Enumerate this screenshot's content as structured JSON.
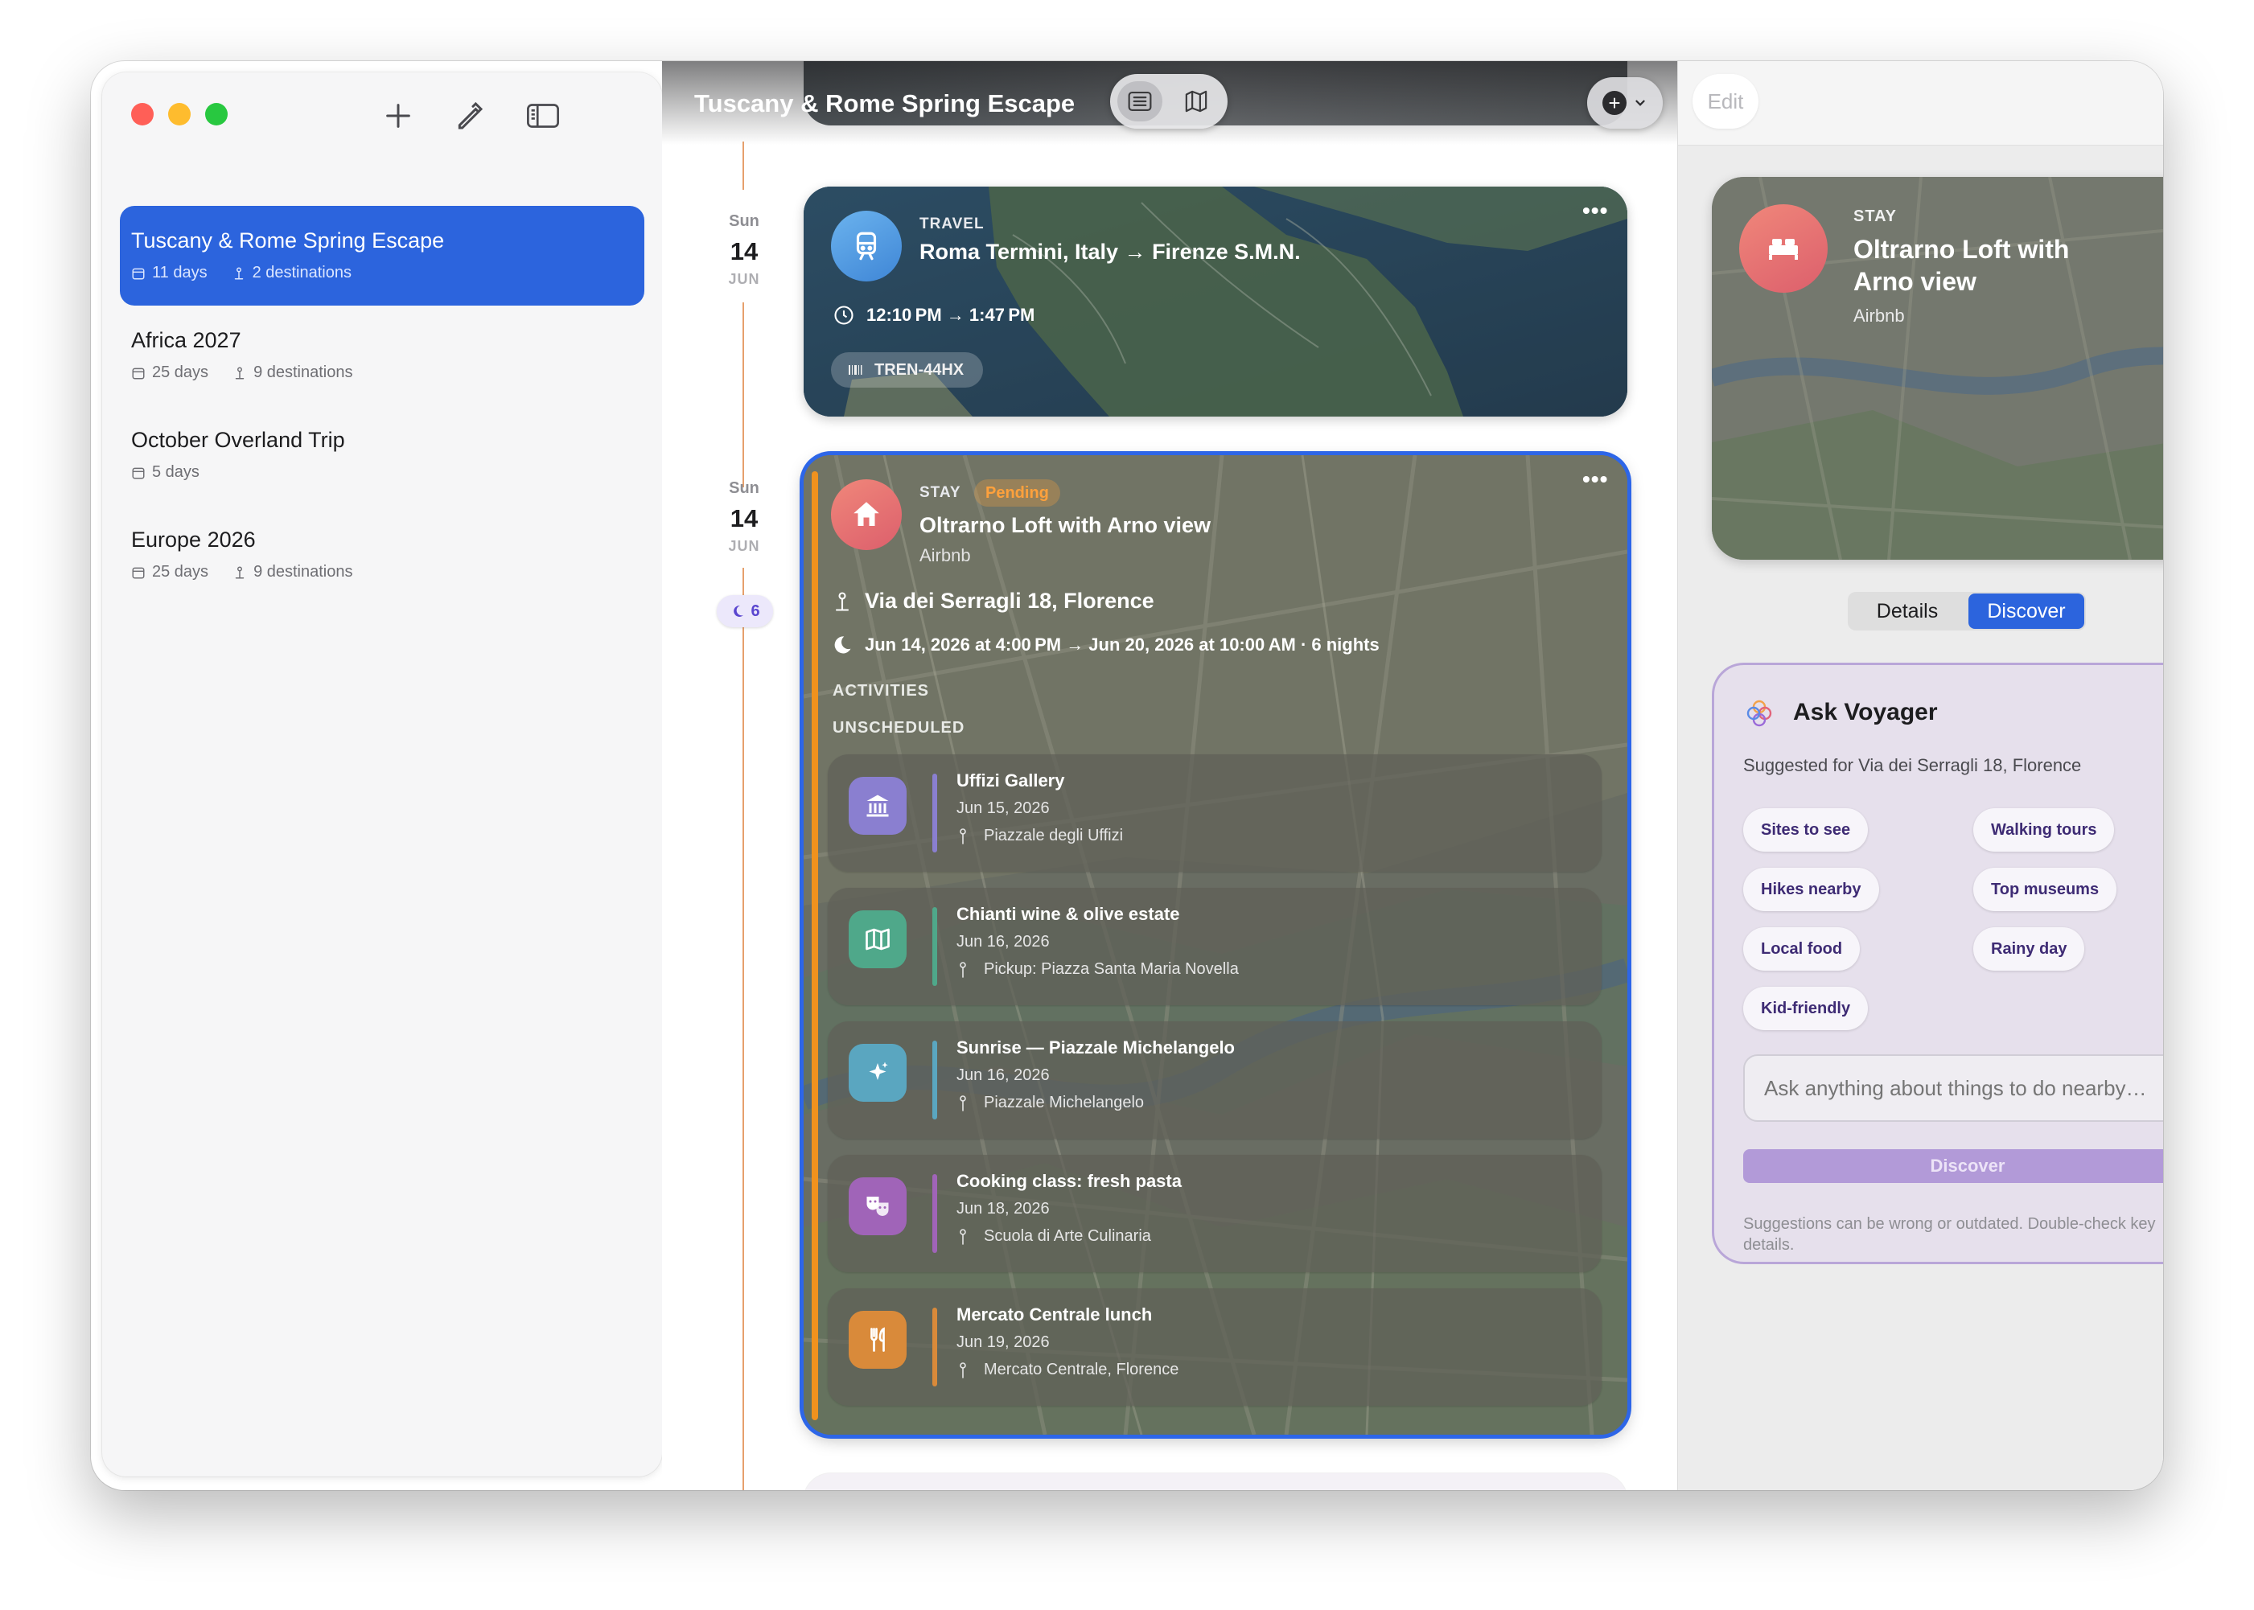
{
  "sidebar": {
    "trips": [
      {
        "title": "Tuscany & Rome Spring Escape",
        "days": "11 days",
        "destinations": "2 destinations"
      },
      {
        "title": "Africa 2027",
        "days": "25 days",
        "destinations": "9 destinations"
      },
      {
        "title": "October Overland Trip",
        "days": "5 days",
        "destinations": ""
      },
      {
        "title": "Europe 2026",
        "days": "25 days",
        "destinations": "9 destinations"
      }
    ]
  },
  "main": {
    "title": "Tuscany & Rome Spring Escape",
    "dates": [
      {
        "dow": "Sun",
        "day": "14",
        "month": "JUN"
      },
      {
        "dow": "Sun",
        "day": "14",
        "month": "JUN"
      }
    ],
    "nights_badge": "6",
    "travel": {
      "kind": "TRAVEL",
      "route": "Roma Termini, Italy → Firenze S.M.N.",
      "time": "12:10 PM → 1:47 PM",
      "ticket": "TREN-44HX",
      "more": "•••"
    },
    "stay": {
      "kind": "STAY",
      "status": "Pending",
      "title": "Oltrarno Loft with Arno view",
      "provider": "Airbnb",
      "address": "Via dei Serragli 18, Florence",
      "dates": "Jun 14, 2026 at 4:00 PM → Jun 20, 2026 at 10:00 AM · 6 nights",
      "activities_label": "ACTIVITIES",
      "unscheduled_label": "UNSCHEDULED",
      "more": "•••",
      "activities": [
        {
          "title": "Uffizi Gallery",
          "date": "Jun 15, 2026",
          "location": "Piazzale degli Uffizi",
          "icon": "museum-icon",
          "color": "#8a7fd0"
        },
        {
          "title": "Chianti wine & olive estate",
          "date": "Jun 16, 2026",
          "location": "Pickup: Piazza Santa Maria Novella",
          "icon": "map-icon",
          "color": "#4fa88a"
        },
        {
          "title": "Sunrise — Piazzale Michelangelo",
          "date": "Jun 16, 2026",
          "location": "Piazzale Michelangelo",
          "icon": "sparkles-icon",
          "color": "#5aa6c0"
        },
        {
          "title": "Cooking class: fresh pasta",
          "date": "Jun 18, 2026",
          "location": "Scuola di Arte Culinaria",
          "icon": "theater-masks-icon",
          "color": "#a064b8"
        },
        {
          "title": "Mercato Centrale lunch",
          "date": "Jun 19, 2026",
          "location": "Mercato Centrale, Florence",
          "icon": "fork-knife-icon",
          "color": "#d98a3a"
        }
      ]
    }
  },
  "inspector": {
    "edit_label": "Edit",
    "card": {
      "kind": "STAY",
      "title": "Oltrarno Loft with Arno view",
      "provider": "Airbnb"
    },
    "tabs": [
      "Details",
      "Discover"
    ],
    "selected_tab": "Discover",
    "voyager": {
      "title": "Ask Voyager",
      "subtitle": "Suggested for Via dei Serragli 18, Florence",
      "chips": [
        "Sites to see",
        "Walking tours",
        "Hikes nearby",
        "Top museums",
        "Local food",
        "Rainy day",
        "Kid-friendly"
      ],
      "input_placeholder": "Ask anything about things to do nearby…",
      "button_label": "Discover",
      "note": "Suggestions can be wrong or outdated. Double-check key details."
    }
  },
  "colors": {
    "accent": "#2c64dd",
    "timeline": "#e6a06c",
    "pending": "#ffa13c",
    "voyager_border": "#b9a6d8"
  }
}
